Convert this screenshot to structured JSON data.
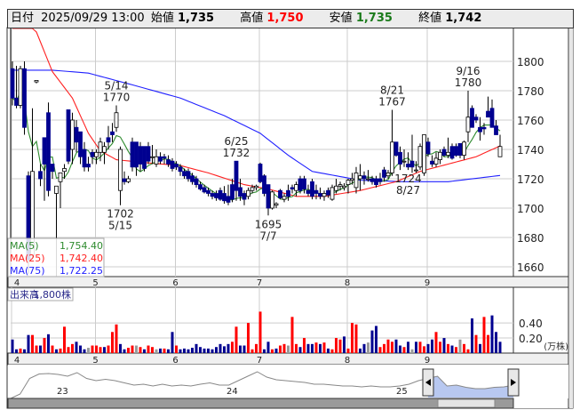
{
  "header": {
    "date_label": "日付",
    "datetime": "2025/09/29 13:00",
    "open_label": "始値",
    "open": "1,735",
    "high_label": "高値",
    "high": "1,750",
    "low_label": "安値",
    "low": "1,735",
    "close_label": "終値",
    "close": "1,742"
  },
  "colors": {
    "up_candle": "#ffffff",
    "down_candle": "#000090",
    "vol_up": "#ff0000",
    "vol_down": "#000090",
    "vol_flat": "#999999",
    "ma5": "#2e8b2e",
    "ma25": "#ff2020",
    "ma75": "#2020ff",
    "high_label": "#ff0000",
    "low_label": "#1a7a1a"
  },
  "legend": {
    "ma5_label": "MA(5)",
    "ma5": "1,754.40",
    "ma25_label": "MA(25)",
    "ma25": "1,742.40",
    "ma75_label": "MA(75)",
    "ma75": "1,722.25"
  },
  "volume_legend": {
    "label": "出来高",
    "value": "1,800株"
  },
  "chart_data": {
    "type": "candlestick",
    "title": "",
    "ylim": [
      1650,
      1820
    ],
    "yticks": [
      "1660",
      "1680",
      "1700",
      "1720",
      "1740",
      "1760",
      "1780",
      "1800"
    ],
    "months": [
      {
        "label": "4",
        "index": 0
      },
      {
        "label": "5",
        "index": 21
      },
      {
        "label": "6",
        "index": 41
      },
      {
        "label": "7",
        "index": 62
      },
      {
        "label": "8",
        "index": 84
      },
      {
        "label": "9",
        "index": 104
      }
    ],
    "candles": [
      [
        1795,
        1800,
        1770,
        1775
      ],
      [
        1775,
        1797,
        1768,
        1770
      ],
      [
        1770,
        1797,
        1768,
        1795
      ],
      [
        1795,
        1800,
        1750,
        1755
      ],
      [
        1722,
        1725,
        1655,
        1665
      ],
      [
        1668,
        1768,
        1665,
        1725
      ],
      [
        1786,
        1787,
        1785,
        1787
      ],
      [
        1725,
        1730,
        1715,
        1720
      ],
      [
        1748,
        1748,
        1705,
        1730
      ],
      [
        1765,
        1772,
        1708,
        1712
      ],
      [
        1730,
        1730,
        1720,
        1725
      ],
      [
        1710,
        1715,
        1650,
        1715
      ],
      [
        1718,
        1724,
        1700,
        1724
      ],
      [
        1725,
        1730,
        1720,
        1727
      ],
      [
        1767,
        1767,
        1730,
        1732
      ],
      [
        1740,
        1765,
        1730,
        1760
      ],
      [
        1755,
        1760,
        1738,
        1745
      ],
      [
        1752,
        1752,
        1730,
        1735
      ],
      [
        1740,
        1745,
        1725,
        1728
      ],
      [
        1730,
        1735,
        1725,
        1728
      ],
      [
        1738,
        1740,
        1730,
        1735
      ],
      [
        1735,
        1740,
        1730,
        1738
      ],
      [
        1738,
        1748,
        1732,
        1745
      ],
      [
        1738,
        1745,
        1730,
        1742
      ],
      [
        1748,
        1756,
        1740,
        1745
      ],
      [
        1752,
        1758,
        1745,
        1750
      ],
      [
        1755,
        1770,
        1752,
        1765
      ],
      [
        1712,
        1742,
        1702,
        1740
      ],
      [
        1720,
        1725,
        1716,
        1718
      ],
      [
        1718,
        1722,
        1717,
        1720
      ],
      [
        1745,
        1748,
        1725,
        1728
      ],
      [
        1745,
        1745,
        1722,
        1728
      ],
      [
        1742,
        1745,
        1725,
        1730
      ],
      [
        1742,
        1742,
        1725,
        1727
      ],
      [
        1742,
        1745,
        1730,
        1732
      ],
      [
        1735,
        1743,
        1730,
        1735
      ],
      [
        1730,
        1740,
        1728,
        1735
      ],
      [
        1735,
        1738,
        1730,
        1732
      ],
      [
        1735,
        1737,
        1730,
        1734
      ],
      [
        1733,
        1736,
        1728,
        1730
      ],
      [
        1732,
        1734,
        1725,
        1727
      ],
      [
        1730,
        1732,
        1726,
        1728
      ],
      [
        1728,
        1730,
        1722,
        1725
      ],
      [
        1725,
        1727,
        1720,
        1722
      ],
      [
        1725,
        1727,
        1718,
        1720
      ],
      [
        1722,
        1724,
        1716,
        1718
      ],
      [
        1720,
        1722,
        1714,
        1716
      ],
      [
        1716,
        1718,
        1712,
        1713
      ],
      [
        1714,
        1716,
        1710,
        1711
      ],
      [
        1712,
        1714,
        1708,
        1710
      ],
      [
        1710,
        1712,
        1706,
        1708
      ],
      [
        1710,
        1712,
        1705,
        1707
      ],
      [
        1712,
        1714,
        1705,
        1706
      ],
      [
        1710,
        1715,
        1703,
        1705
      ],
      [
        1708,
        1716,
        1702,
        1704
      ],
      [
        1716,
        1720,
        1704,
        1706
      ],
      [
        1732,
        1732,
        1705,
        1712
      ],
      [
        1714,
        1720,
        1705,
        1708
      ],
      [
        1710,
        1712,
        1702,
        1706
      ],
      [
        1708,
        1714,
        1706,
        1712
      ],
      [
        1712,
        1716,
        1710,
        1714
      ],
      [
        1714,
        1716,
        1712,
        1715
      ],
      [
        1730,
        1731,
        1717,
        1718
      ],
      [
        1722,
        1723,
        1708,
        1710
      ],
      [
        1716,
        1716,
        1695,
        1700
      ],
      [
        1700,
        1712,
        1699,
        1711
      ],
      [
        1702,
        1704,
        1700,
        1703
      ],
      [
        1712,
        1713,
        1706,
        1707
      ],
      [
        1706,
        1710,
        1704,
        1708
      ],
      [
        1712,
        1716,
        1705,
        1708
      ],
      [
        1714,
        1716,
        1710,
        1713
      ],
      [
        1712,
        1718,
        1708,
        1716
      ],
      [
        1720,
        1722,
        1710,
        1712
      ],
      [
        1720,
        1722,
        1710,
        1713
      ],
      [
        1712,
        1716,
        1708,
        1710
      ],
      [
        1718,
        1720,
        1706,
        1708
      ],
      [
        1712,
        1716,
        1706,
        1710
      ],
      [
        1710,
        1714,
        1706,
        1708
      ],
      [
        1708,
        1712,
        1705,
        1710
      ],
      [
        1712,
        1714,
        1707,
        1709
      ],
      [
        1706,
        1716,
        1705,
        1714
      ],
      [
        1712,
        1720,
        1710,
        1715
      ],
      [
        1715,
        1718,
        1712,
        1716
      ],
      [
        1714,
        1717,
        1712,
        1715
      ],
      [
        1716,
        1720,
        1710,
        1719
      ],
      [
        1719,
        1724,
        1716,
        1720
      ],
      [
        1714,
        1728,
        1710,
        1724
      ],
      [
        1720,
        1730,
        1712,
        1722
      ],
      [
        1722,
        1725,
        1716,
        1720
      ],
      [
        1720,
        1726,
        1718,
        1720
      ],
      [
        1720,
        1722,
        1716,
        1718
      ],
      [
        1720,
        1722,
        1714,
        1716
      ],
      [
        1720,
        1724,
        1716,
        1718
      ],
      [
        1726,
        1728,
        1718,
        1721
      ],
      [
        1722,
        1726,
        1720,
        1724
      ],
      [
        1724,
        1767,
        1722,
        1745
      ],
      [
        1745,
        1745,
        1735,
        1736
      ],
      [
        1738,
        1742,
        1726,
        1730
      ],
      [
        1732,
        1740,
        1728,
        1732
      ],
      [
        1730,
        1738,
        1726,
        1728
      ],
      [
        1732,
        1750,
        1724,
        1728
      ],
      [
        1726,
        1732,
        1724,
        1726
      ],
      [
        1728,
        1744,
        1726,
        1742
      ],
      [
        1724,
        1750,
        1722,
        1750
      ],
      [
        1745,
        1748,
        1735,
        1737
      ],
      [
        1732,
        1736,
        1728,
        1730
      ],
      [
        1730,
        1738,
        1728,
        1734
      ],
      [
        1733,
        1740,
        1730,
        1738
      ],
      [
        1740,
        1742,
        1735,
        1736
      ],
      [
        1736,
        1748,
        1734,
        1738
      ],
      [
        1742,
        1744,
        1733,
        1734
      ],
      [
        1742,
        1744,
        1735,
        1736
      ],
      [
        1744,
        1744,
        1734,
        1736
      ],
      [
        1736,
        1746,
        1733,
        1745
      ],
      [
        1752,
        1780,
        1745,
        1762
      ],
      [
        1768,
        1770,
        1755,
        1755
      ],
      [
        1762,
        1764,
        1758,
        1760
      ],
      [
        1755,
        1762,
        1746,
        1752
      ],
      [
        1755,
        1758,
        1750,
        1754
      ],
      [
        1766,
        1776,
        1762,
        1762
      ],
      [
        1768,
        1774,
        1756,
        1755
      ],
      [
        1756,
        1760,
        1750,
        1750
      ],
      [
        1735,
        1750,
        1735,
        1742
      ]
    ],
    "ma25_points": [
      [
        0,
        1840
      ],
      [
        6,
        1820
      ],
      [
        10,
        1793
      ],
      [
        15,
        1775
      ],
      [
        19,
        1751
      ],
      [
        22,
        1739
      ],
      [
        26,
        1733
      ],
      [
        33,
        1731
      ],
      [
        42,
        1729
      ],
      [
        49,
        1724
      ],
      [
        58,
        1716
      ],
      [
        64,
        1713
      ],
      [
        71,
        1708
      ],
      [
        78,
        1708
      ],
      [
        87,
        1712
      ],
      [
        96,
        1718
      ],
      [
        102,
        1725
      ],
      [
        109,
        1730
      ],
      [
        116,
        1735
      ],
      [
        122,
        1742.4
      ]
    ],
    "ma75_points": [
      [
        0,
        1794
      ],
      [
        10,
        1794
      ],
      [
        19,
        1792
      ],
      [
        30,
        1784
      ],
      [
        42,
        1775
      ],
      [
        53,
        1763
      ],
      [
        62,
        1751
      ],
      [
        69,
        1736
      ],
      [
        75,
        1725
      ],
      [
        87,
        1719
      ],
      [
        98,
        1718
      ],
      [
        109,
        1718
      ],
      [
        122,
        1722.25
      ]
    ],
    "annotations": [
      {
        "index": 26,
        "date": "5/14",
        "price": "1770",
        "pos": "above"
      },
      {
        "index": 27,
        "date": "5/15",
        "price": "1702",
        "pos": "below"
      },
      {
        "index": 56,
        "date": "6/25",
        "price": "1732",
        "pos": "above"
      },
      {
        "index": 64,
        "date": "7/7",
        "price": "1695",
        "pos": "below"
      },
      {
        "index": 95,
        "date": "8/21",
        "price": "1767",
        "pos": "above"
      },
      {
        "index": 99,
        "date": "8/27",
        "price": "1724",
        "pos": "below"
      },
      {
        "index": 114,
        "date": "9/16",
        "price": "1780",
        "pos": "above"
      }
    ],
    "volume": {
      "unit": "(万株)",
      "yticks": [
        "0.20",
        "0.40"
      ],
      "ylim": [
        0,
        0.85
      ],
      "values": [
        0.18,
        0.05,
        0.06,
        0.05,
        0.24,
        0.24,
        0.1,
        0.1,
        0.2,
        0.25,
        0.1,
        0.05,
        0.06,
        0.35,
        0.08,
        0.12,
        0.15,
        0.1,
        0.05,
        0.07,
        0.1,
        0.1,
        0.08,
        0.08,
        0.1,
        0.28,
        0.38,
        0.12,
        0.05,
        0.07,
        0.1,
        0.1,
        0.08,
        0.05,
        0.1,
        0.08,
        0.05,
        0.06,
        0.06,
        0.05,
        0.28,
        0.1,
        0.05,
        0.06,
        0.05,
        0.07,
        0.12,
        0.08,
        0.06,
        0.06,
        0.05,
        0.08,
        0.12,
        0.09,
        0.12,
        0.15,
        0.35,
        0.1,
        0.1,
        0.4,
        0.05,
        0.12,
        0.55,
        0.05,
        0.15,
        0.05,
        0.06,
        0.1,
        0.12,
        0.1,
        0.48,
        0.12,
        0.08,
        0.2,
        0.12,
        0.12,
        0.14,
        0.12,
        0.14,
        0.06,
        0.05,
        0.2,
        0.18,
        0.22,
        0.06,
        0.4,
        0.38,
        0.06,
        0.12,
        0.14,
        0.3,
        0.36,
        0.08,
        0.12,
        0.18,
        0.15,
        0.18,
        0.1,
        0.08,
        0.15,
        0.05,
        0.15,
        0.15,
        0.09,
        0.12,
        0.18,
        0.28,
        0.15,
        0.2,
        0.12,
        0.1,
        0.08,
        0.18,
        0.12,
        0.05,
        0.46,
        0.24,
        0.12,
        0.48,
        0.24,
        0.5,
        0.28,
        0.15,
        0.18
      ]
    },
    "navigator": {
      "labels": [
        "23",
        "24",
        "25"
      ],
      "series": [
        1690,
        1700,
        1735,
        1745,
        1746,
        1744,
        1740,
        1748,
        1735,
        1730,
        1733,
        1730,
        1725,
        1720,
        1722,
        1718,
        1722,
        1718,
        1720,
        1718,
        1722,
        1725,
        1720,
        1720,
        1730,
        1740,
        1750,
        1738,
        1732,
        1730,
        1728,
        1726,
        1722,
        1722,
        1720,
        1718,
        1718,
        1716,
        1718,
        1716,
        1716,
        1718,
        1722,
        1730,
        1735,
        1740,
        1718,
        1720,
        1715,
        1712,
        1712,
        1715,
        1716,
        1720
      ]
    }
  }
}
